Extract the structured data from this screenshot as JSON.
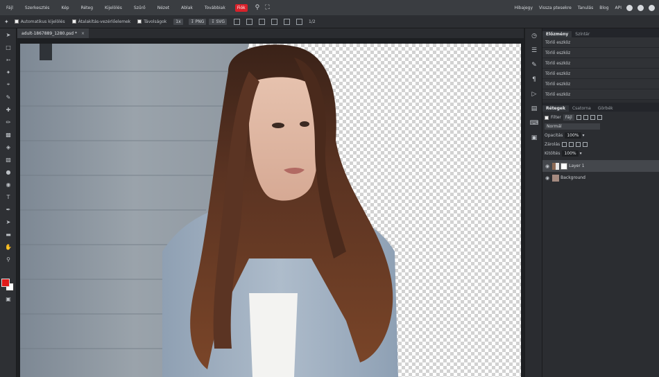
{
  "menu": {
    "items": [
      "Fájl",
      "Szerkesztés",
      "Kép",
      "Réteg",
      "Kijelölés",
      "Szűrő",
      "Nézet",
      "Ablak",
      "Továbbiak",
      "Fiók"
    ],
    "active_index": 9,
    "right_links": [
      "Hibajegy",
      "Vissza ptesekre",
      "Tanulás",
      "Blog",
      "API"
    ]
  },
  "options": {
    "auto_select": "Automatikus kijelölés",
    "transform": "Átalakítás-vezérlőelemek",
    "distances": "Távolságok",
    "zoom": "1x",
    "png": "PNG",
    "svg": "SVG",
    "count": "1/2"
  },
  "document": {
    "tab_title": "adult-1867889_1280.psd *",
    "close": "×"
  },
  "history": {
    "tabs": [
      "Előzmény",
      "Színtár"
    ],
    "items": [
      "Törlő eszköz",
      "Törlő eszköz",
      "Törlő eszköz",
      "Törlő eszköz",
      "Törlő eszköz",
      "Törlő eszköz"
    ]
  },
  "layers": {
    "tabs": [
      "Rétegek",
      "Csatorna",
      "Görbék"
    ],
    "filter": "Filter",
    "kind": "Fájl",
    "blend": "Normál",
    "opacity_label": "Opacitás",
    "opacity": "100%",
    "lock_label": "Zárolás",
    "fill_label": "Kitöltés",
    "fill": "100%",
    "list": [
      {
        "name": "Layer 1",
        "selected": true
      },
      {
        "name": "Background",
        "selected": false
      }
    ]
  },
  "colors": {
    "foreground": "#e11a1a",
    "background": "#ffffff",
    "accent": "#d8212a"
  }
}
